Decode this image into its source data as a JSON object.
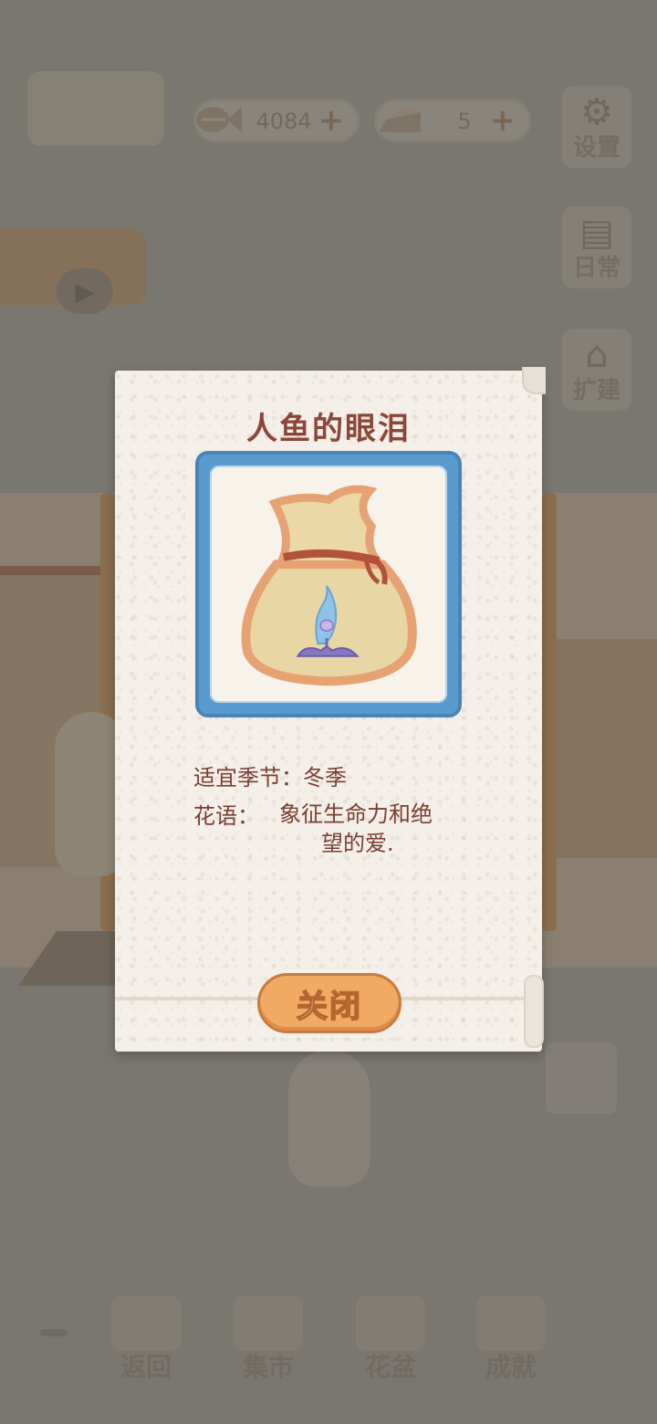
{
  "topbar": {
    "fish_value": "4084",
    "cheese_value": "5",
    "plus_glyph": "+",
    "fish_icon": "fish-bone-icon",
    "cheese_icon": "cheese-icon"
  },
  "side_buttons": {
    "settings_label": "设置",
    "daily_label": "日常",
    "expand_label": "扩建"
  },
  "dialog": {
    "title": "人鱼的眼泪",
    "season_line": "适宜季节：冬季",
    "flower_label": "花语：",
    "flower_text_line1": "象征生命力和绝",
    "flower_text_line2": "望的爱.",
    "close_label": "关闭",
    "frame_color": "#5a9bcf",
    "item_icon": "seed-bag-icon"
  },
  "bottom_nav": {
    "items": [
      {
        "label": "返回",
        "icon": "back-icon"
      },
      {
        "label": "集市",
        "icon": "market-icon"
      },
      {
        "label": "花盆",
        "icon": "flowerpot-icon"
      },
      {
        "label": "成就",
        "icon": "achievement-icon"
      }
    ]
  },
  "colors": {
    "overlay": "#7a7670",
    "title_text": "#8b4638",
    "button_orange": "#f2a964"
  }
}
